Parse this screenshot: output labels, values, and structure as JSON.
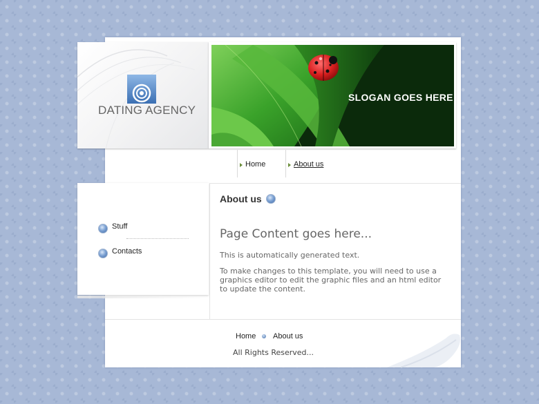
{
  "logo": {
    "text": "DATING AGENCY",
    "icon": "logo-ring-icon"
  },
  "banner": {
    "slogan": "SLOGAN GOES HERE"
  },
  "top_nav": [
    {
      "label": "Home",
      "active": false
    },
    {
      "label": "About us",
      "active": true
    }
  ],
  "sidebar": {
    "items": [
      {
        "label": "Stuff",
        "icon": "bullet-icon"
      },
      {
        "label": "Contacts",
        "icon": "bullet-icon"
      }
    ]
  },
  "main": {
    "section_title": "About us",
    "heading": "Page Content goes here...",
    "paragraphs": [
      "This is automatically generated text.",
      "To make changes to this template, you will need to use a graphics editor to edit the graphic files and an html editor to update the content."
    ]
  },
  "footer": {
    "links": [
      "Home",
      "About us"
    ],
    "copyright": "All Rights Reserved..."
  },
  "colors": {
    "background": "#a7b8d6",
    "accent": "#3f6aa8",
    "banner_dark": "#0b2a0b",
    "leaf": "#3aa22a",
    "ladybug": "#d81f1f"
  }
}
